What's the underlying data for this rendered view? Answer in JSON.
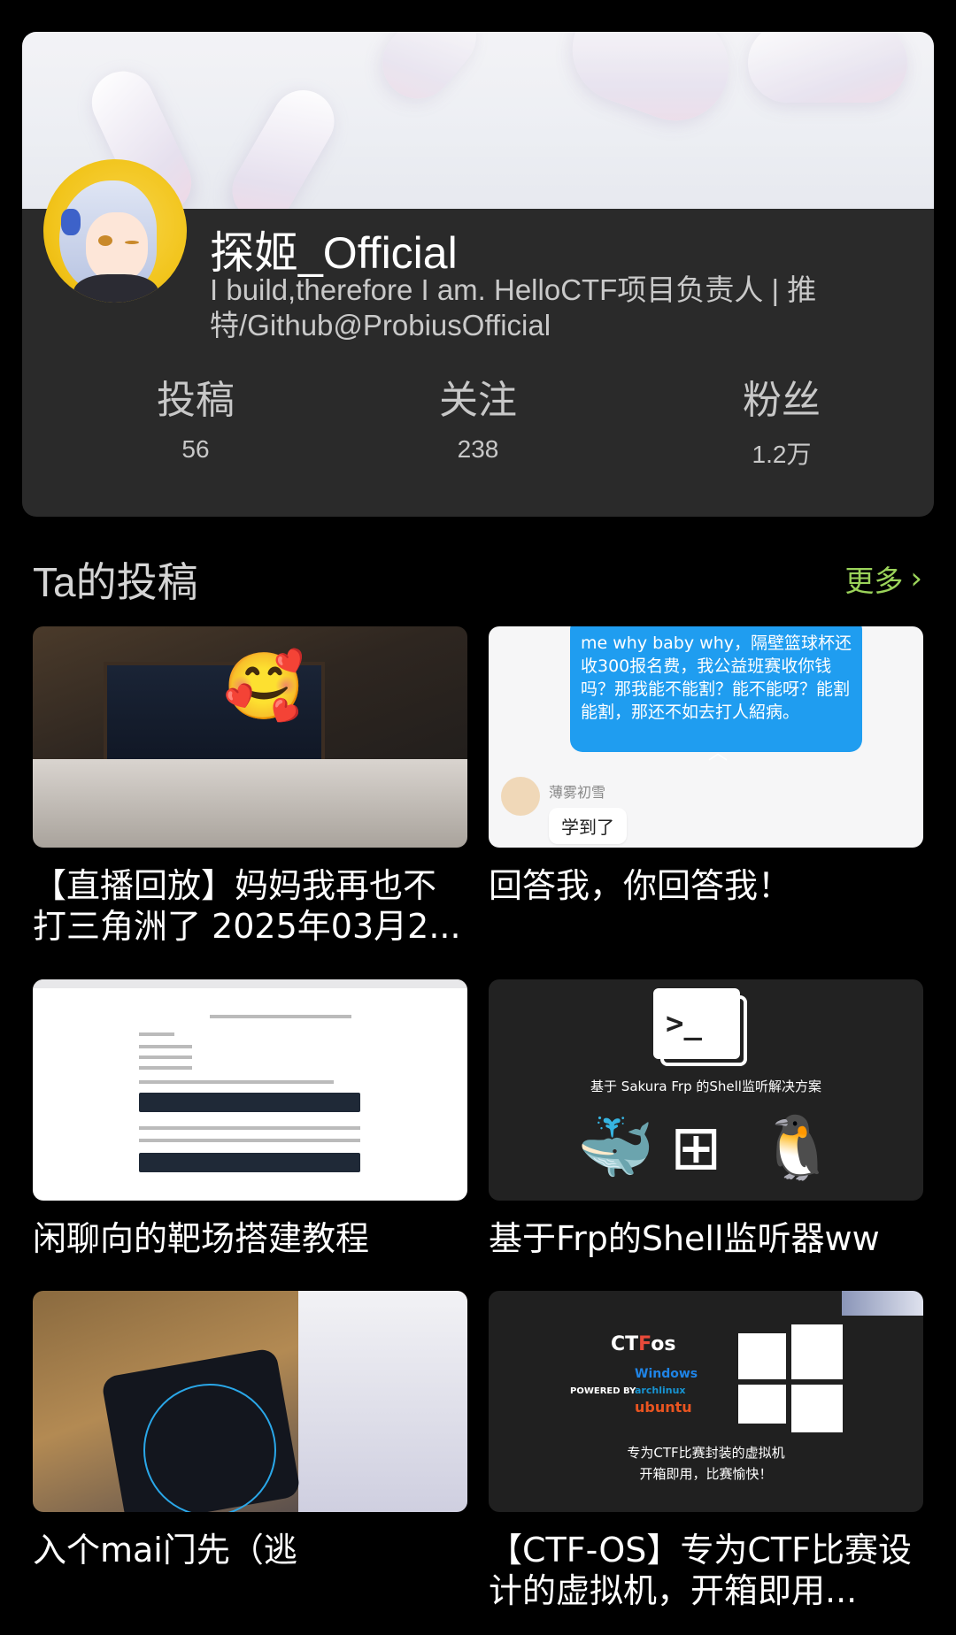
{
  "profile": {
    "name": "探姬_Official",
    "bio": "I build,therefore I am. HelloCTF项目负责人 | 推特/Github@ProbiusOfficial",
    "stats": [
      {
        "label": "投稿",
        "value": "56"
      },
      {
        "label": "关注",
        "value": "238"
      },
      {
        "label": "粉丝",
        "value": "1.2万"
      }
    ]
  },
  "section": {
    "title": "Ta的投稿",
    "more_label": "更多"
  },
  "posts": [
    {
      "title": "【直播回放】妈妈我再也不打三角洲了 2025年03月2..."
    },
    {
      "title": "回答我，你回答我！"
    },
    {
      "title": "闲聊向的靶场搭建教程"
    },
    {
      "title": "基于Frp的Shell监听器ww"
    },
    {
      "title": "入个mai门先（逃"
    },
    {
      "title": "【CTF-OS】专为CTF比赛设计的虚拟机，开箱即用..."
    }
  ],
  "thumbs": {
    "t2": {
      "bubble": "me why baby why，隔壁篮球杯还收300报名费，我公益班赛收你钱吗？那我能不能割？能不能呀？能割能割，那还不如去打人紹病。",
      "nick": "薄雾初雪",
      "msg": "学到了"
    },
    "t4": {
      "caption": "基于 Sakura Frp 的Shell监听解决方案",
      "prompt": ">_"
    },
    "t6": {
      "brand_ctf": "CT",
      "brand_f": "F",
      "brand_os": "os",
      "powered": "POWERED BY",
      "os1": "Windows",
      "os2": "archlinux",
      "os3": "ubuntu",
      "line1": "专为CTF比赛封装的虚拟机",
      "line2": "开箱即用，比赛愉快！"
    }
  },
  "colors": {
    "accent_more": "#9bd35a",
    "card_bg": "#2a2a2a",
    "page_bg": "#000000"
  }
}
